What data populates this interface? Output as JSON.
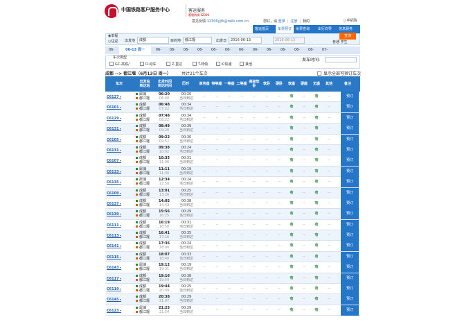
{
  "header": {
    "org_name": "中国铁路客户服务中心",
    "service": "客运服务",
    "hotline": "客服热线:12306",
    "feedback_label": "意见反馈:",
    "feedback_email": "12306yjfk@rails.com.cn",
    "greeting": "您好，请",
    "login": "登录",
    "register": "注册",
    "my_account": "我的",
    "mobile": "手机购"
  },
  "nav": {
    "items": [
      "客运首页",
      "车票预订",
      "余票查询",
      "出行向导",
      "信息服务"
    ],
    "active_index": 1
  },
  "query": {
    "trip_single": "单程",
    "trip_round": "往返",
    "from_label": "出发地",
    "from_value": "成都",
    "to_label": "目的地",
    "to_value": "都江堰",
    "date_label": "出发日",
    "date_value": "2016-06-13",
    "return_date_value": "2016-06-13",
    "search_button": "查询",
    "passenger_types": "普通 学生"
  },
  "date_tabs": [
    "06-",
    "06-13 周一",
    "06-",
    "06-",
    "06-",
    "06-",
    "06-",
    "06-",
    "06-",
    "06-",
    "06-",
    "06-",
    "06-",
    "06-",
    "07-"
  ],
  "date_active_index": 1,
  "filter": {
    "train_type_label": "车次类型",
    "types": [
      "GC-高铁/",
      "D-动车",
      "Z-直达",
      "T-特快",
      "K-快速",
      "其他"
    ],
    "depart_time_label": "发车时间:"
  },
  "result": {
    "route": "成都 --> 都江堰（6月13日 周一）",
    "count": "共计21个车次",
    "show_all": "显示全部可预订车次"
  },
  "table": {
    "columns": [
      "车次",
      "出发站\n到达站",
      "出发时间\n到达时间",
      "历时",
      "商务座",
      "特等座",
      "一等座",
      "二等座",
      "高级软卧",
      "软卧",
      "硬卧",
      "软座",
      "硬座",
      "无座",
      "其他",
      "备注"
    ],
    "book_label": "预订",
    "dash": "--",
    "has": "有",
    "rows": [
      {
        "train": "C6127",
        "from": "犀浦",
        "to": "都江堰",
        "dep": "06:20",
        "arr": "06:40",
        "dur": "00:20",
        "arrival_day": "当日到达"
      },
      {
        "train": "C6101",
        "from": "成都",
        "to": "都江堰",
        "dep": "06:48",
        "arr": "07:22",
        "dur": "00:34",
        "arrival_day": "当日到达"
      },
      {
        "train": "C6129",
        "from": "成都",
        "to": "都江堰",
        "dep": "07:48",
        "arr": "08:22",
        "dur": "00:34",
        "arrival_day": "当日到达"
      },
      {
        "train": "C6131",
        "from": "成都",
        "to": "都江堰",
        "dep": "08:49",
        "arr": "09:28",
        "dur": "00:39",
        "arrival_day": "当日到达"
      },
      {
        "train": "C6105",
        "from": "成都",
        "to": "都江堰",
        "dep": "09:22",
        "arr": "09:52",
        "dur": "00:30",
        "arrival_day": "当日到达"
      },
      {
        "train": "C6131",
        "from": "成都",
        "to": "都江堰",
        "dep": "09:38",
        "arr": "10:02",
        "dur": "00:24",
        "arrival_day": "当日到达"
      },
      {
        "train": "C6107",
        "from": "成都",
        "to": "都江堰",
        "dep": "10:35",
        "arr": "11:06",
        "dur": "00:31",
        "arrival_day": "当日到达"
      },
      {
        "train": "C6133",
        "from": "犀浦",
        "to": "都江堰",
        "dep": "11:11",
        "arr": "11:30",
        "dur": "00:19",
        "arrival_day": "当日到达"
      },
      {
        "train": "C6135",
        "from": "犀浦",
        "to": "都江堰",
        "dep": "12:34",
        "arr": "12:58",
        "dur": "00:24",
        "arrival_day": "当日到达"
      },
      {
        "train": "C6109",
        "from": "成都",
        "to": "都江堰",
        "dep": "13:01",
        "arr": "13:26",
        "dur": "00:25",
        "arrival_day": "当日到达"
      },
      {
        "train": "C6137",
        "from": "成都",
        "to": "都江堰",
        "dep": "14:05",
        "arr": "14:43",
        "dur": "00:38",
        "arrival_day": "当日到达"
      },
      {
        "train": "C6139",
        "from": "成都",
        "to": "都江堰",
        "dep": "15:56",
        "arr": "16:25",
        "dur": "00:29",
        "arrival_day": "当日到达"
      },
      {
        "train": "C6111",
        "from": "成都",
        "to": "都江堰",
        "dep": "16:19",
        "arr": "16:50",
        "dur": "00:31",
        "arrival_day": "当日到达"
      },
      {
        "train": "C6113",
        "from": "成都",
        "to": "都江堰",
        "dep": "16:41",
        "arr": "17:16",
        "dur": "00:35",
        "arrival_day": "当日到达"
      },
      {
        "train": "C6141",
        "from": "成都",
        "to": "都江堰",
        "dep": "17:36",
        "arr": "18:00",
        "dur": "00:24",
        "arrival_day": "当日到达"
      },
      {
        "train": "C6115",
        "from": "成都",
        "to": "都江堰",
        "dep": "18:07",
        "arr": "18:40",
        "dur": "00:33",
        "arrival_day": "当日到达"
      },
      {
        "train": "C6143",
        "from": "犀浦",
        "to": "都江堰",
        "dep": "19:12",
        "arr": "19:31",
        "dur": "00:19",
        "arrival_day": "当日到达"
      },
      {
        "train": "C6117",
        "from": "成都",
        "to": "都江堰",
        "dep": "19:16",
        "arr": "19:54",
        "dur": "00:38",
        "arrival_day": "当日到达"
      },
      {
        "train": "C6119",
        "from": "成都",
        "to": "都江堰",
        "dep": "19:44",
        "arr": "20:09",
        "dur": "00:25",
        "arrival_day": "当日到达"
      },
      {
        "train": "C6145",
        "from": "成都",
        "to": "都江堰",
        "dep": "20:38",
        "arr": "21:07",
        "dur": "00:29",
        "arrival_day": "当日到达"
      },
      {
        "train": "C6123",
        "from": "犀浦",
        "to": "都江堰",
        "dep": "21:25",
        "arr": "21:54",
        "dur": "00:29",
        "arrival_day": "当日到达"
      }
    ]
  },
  "colors": {
    "primary_blue": "#2576c9",
    "header_blue": "#2b78c5",
    "orange": "#ff6600",
    "logo_red": "#c8102e",
    "available_green": "#2b8a3e"
  }
}
